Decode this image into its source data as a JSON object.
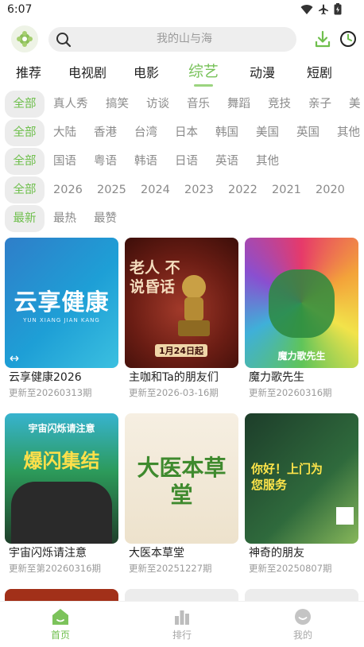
{
  "status_bar": {
    "time": "6:07"
  },
  "header": {
    "search_placeholder": "我的山与海"
  },
  "main_tabs": [
    {
      "label": "推荐"
    },
    {
      "label": "电视剧"
    },
    {
      "label": "电影"
    },
    {
      "label": "综艺"
    },
    {
      "label": "动漫"
    },
    {
      "label": "短剧"
    }
  ],
  "active_tab": "综艺",
  "filters": {
    "type": [
      "全部",
      "真人秀",
      "搞笑",
      "访谈",
      "音乐",
      "舞蹈",
      "竞技",
      "亲子",
      "美"
    ],
    "region": [
      "全部",
      "大陆",
      "香港",
      "台湾",
      "日本",
      "韩国",
      "美国",
      "英国",
      "其他"
    ],
    "language": [
      "全部",
      "国语",
      "粤语",
      "韩语",
      "日语",
      "英语",
      "其他"
    ],
    "year": [
      "全部",
      "2026",
      "2025",
      "2024",
      "2023",
      "2022",
      "2021",
      "2020"
    ],
    "sort": [
      "最新",
      "最热",
      "最赞"
    ]
  },
  "cards": [
    {
      "title": "云享健康2026",
      "subtitle": "更新至20260313期",
      "poster_text": "云享健康",
      "poster_sub": "YUN XIANG JIAN KANG"
    },
    {
      "title": "主咖和Ta的朋友们",
      "subtitle": "更新至2026-03-16期",
      "poster_text": "老人 不说昏话",
      "poster_sub": "1月24日起"
    },
    {
      "title": "魔力歌先生",
      "subtitle": "更新至20260316期",
      "poster_text": "魔力歌先生",
      "poster_sub": ""
    },
    {
      "title": "宇宙闪烁请注意",
      "subtitle": "更新至第20260316期",
      "poster_text": "爆闪集结",
      "poster_sub": "宇宙闪烁请注意"
    },
    {
      "title": "大医本草堂",
      "subtitle": "更新至20251227期",
      "poster_text": "大医本草堂",
      "poster_sub": ""
    },
    {
      "title": "神奇的朋友",
      "subtitle": "更新至20250807期",
      "poster_text": "你好！上门为您服务",
      "poster_sub": ""
    }
  ],
  "bottom_nav": [
    {
      "label": "首页"
    },
    {
      "label": "排行"
    },
    {
      "label": "我的"
    }
  ],
  "colors": {
    "accent": "#6fbf4d",
    "chip_bg": "#ececec",
    "muted_text": "#8a8a8a"
  }
}
